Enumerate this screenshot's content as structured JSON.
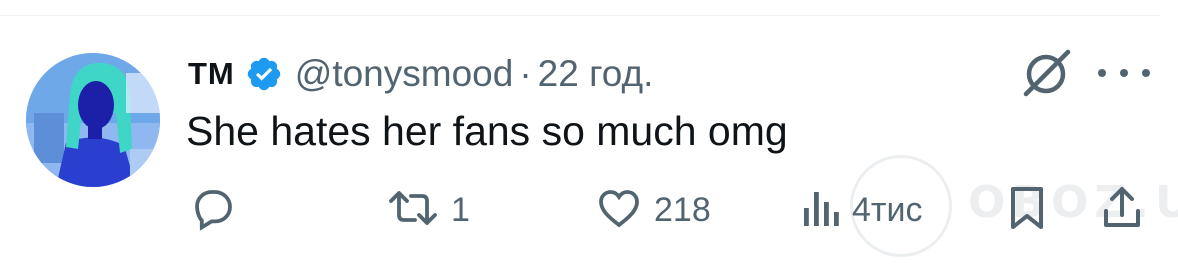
{
  "tweet": {
    "display_name": "TM",
    "handle": "@tonysmood",
    "separator": "·",
    "time": "22 год.",
    "text": "She hates her fans so much omg",
    "verified": true
  },
  "actions": {
    "reply_count": "",
    "retweet_count": "1",
    "like_count": "218",
    "views_count": "4тис"
  },
  "watermark": {
    "text": "OBOZ.UA"
  },
  "icons": {
    "verified": "verified-badge-icon",
    "grok": "grok-icon",
    "more": "more-dots-icon",
    "reply": "reply-icon",
    "retweet": "retweet-icon",
    "like": "heart-icon",
    "views": "views-chart-icon",
    "bookmark": "bookmark-icon",
    "share": "share-icon"
  },
  "colors": {
    "text_primary": "#0f1419",
    "text_secondary": "#536471",
    "verified_blue": "#1d9bf0",
    "divider": "#eff3f4"
  }
}
